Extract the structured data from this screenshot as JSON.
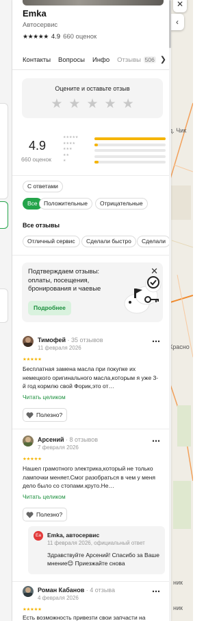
{
  "org": {
    "name": "Emka",
    "category": "Автосервис",
    "stars": "★★★★★",
    "rating": "4.9",
    "rating_count": "660 оценок"
  },
  "tabs": [
    {
      "label": "Контакты"
    },
    {
      "label": "Вопросы"
    },
    {
      "label": "Инфо"
    },
    {
      "label": "Отзывы",
      "badge": "506",
      "active": true
    }
  ],
  "rate_prompt": {
    "title": "Оцените и оставьте отзыв",
    "stars": "★★★★★"
  },
  "summary": {
    "rating": "4.9",
    "count": "660 оценок",
    "distribution": [
      {
        "stars": "★★★★★",
        "fraction": 1.0
      },
      {
        "stars": "★★★★",
        "fraction": 0.05
      },
      {
        "stars": "★★★",
        "fraction": 0.0
      },
      {
        "stars": "★★",
        "fraction": 0.0
      },
      {
        "stars": "★",
        "fraction": 0.06
      }
    ]
  },
  "filters": {
    "with_answers": "С ответами",
    "sentiment": [
      "Все",
      "Положительные",
      "Отрицательные"
    ]
  },
  "all_reviews": {
    "title": "Все отзывы",
    "topics": [
      "Отличный сервис",
      "Сделали быстро",
      "Сделали"
    ]
  },
  "promo": {
    "text": "Подтверждаем отзывы: оплаты, посещения, бронирования и чаевые",
    "button": "Подробнее"
  },
  "reviews": [
    {
      "name": "Тимофей",
      "count": " · 35 отзывов",
      "date": "11 февраля 2026",
      "stars": "★★★★★",
      "text": "Бесплатная замена масла при покупке их немецкого оригинального масла,которым я уже 3-й год кормлю свой Форик,это от…",
      "link": "Читать целиком",
      "useful": "Полезно?"
    },
    {
      "name": "Арсений",
      "count": " · 8 отзывов",
      "date": "7 февраля 2026",
      "stars": "★★★★★",
      "text": "Нашел грамотного электрика,который не только лампочки меняет.Смог разобраться в чем у меня дело было со стопами.круто.Не…",
      "link": "Читать целиком",
      "useful": "Полезно?"
    },
    {
      "name": "Роман Кабанов",
      "count": " · 4 отзыва",
      "date": "4 февраля 2026",
      "stars": "★★★★★",
      "text": "Есть возможность привезти свои запчасти на"
    }
  ],
  "owner_reply": {
    "avatar": "Ea",
    "name": "Emka, автосервис",
    "date": "11 февраля 2026, официальный ответ",
    "text": "Здравствуйте Арсений! Спасибо за Ваше мнение😊 Приезжайте снова"
  },
  "map_labels": [
    "д. Чик",
    "Красно",
    "ник",
    "ник"
  ],
  "colors": {
    "accent_green": "#24a44a",
    "star_yellow": "#f5b400"
  }
}
